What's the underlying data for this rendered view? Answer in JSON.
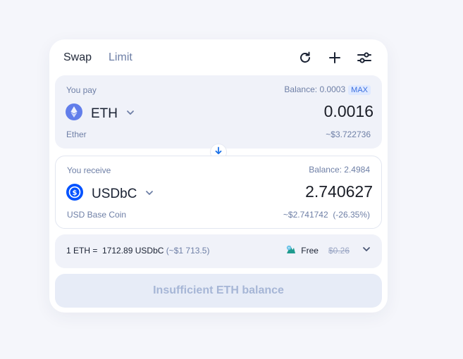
{
  "tabs": [
    {
      "label": "Swap"
    },
    {
      "label": "Limit"
    }
  ],
  "toolbar": {
    "icons": [
      "refresh-icon",
      "plus-icon",
      "settings-sliders-icon"
    ]
  },
  "pay": {
    "label": "You pay",
    "balance": "Balance: 0.0003",
    "max_label": "MAX",
    "token": "ETH",
    "token_full_name": "Ether",
    "amount": "0.0016",
    "usd_value": "~$3.722736"
  },
  "receive": {
    "label": "You receive",
    "balance": "Balance: 2.4984",
    "token": "USDbC",
    "token_full_name": "USD Base Coin",
    "amount": "2.740627",
    "usd_value": "~$2.741742",
    "price_impact": "(-26.35%)"
  },
  "rate": {
    "text": "1 ETH =  1712.89 USDbC",
    "usd": "(~$1 713.5)"
  },
  "fee": {
    "label": "Free",
    "old_value": "$0.26"
  },
  "action": {
    "label": "Insufficient ETH balance"
  },
  "colors": {
    "accent": "#1e73e8",
    "eth": "#627eea",
    "usdbc": "#0052ff",
    "muted": "#6e7fa6"
  }
}
